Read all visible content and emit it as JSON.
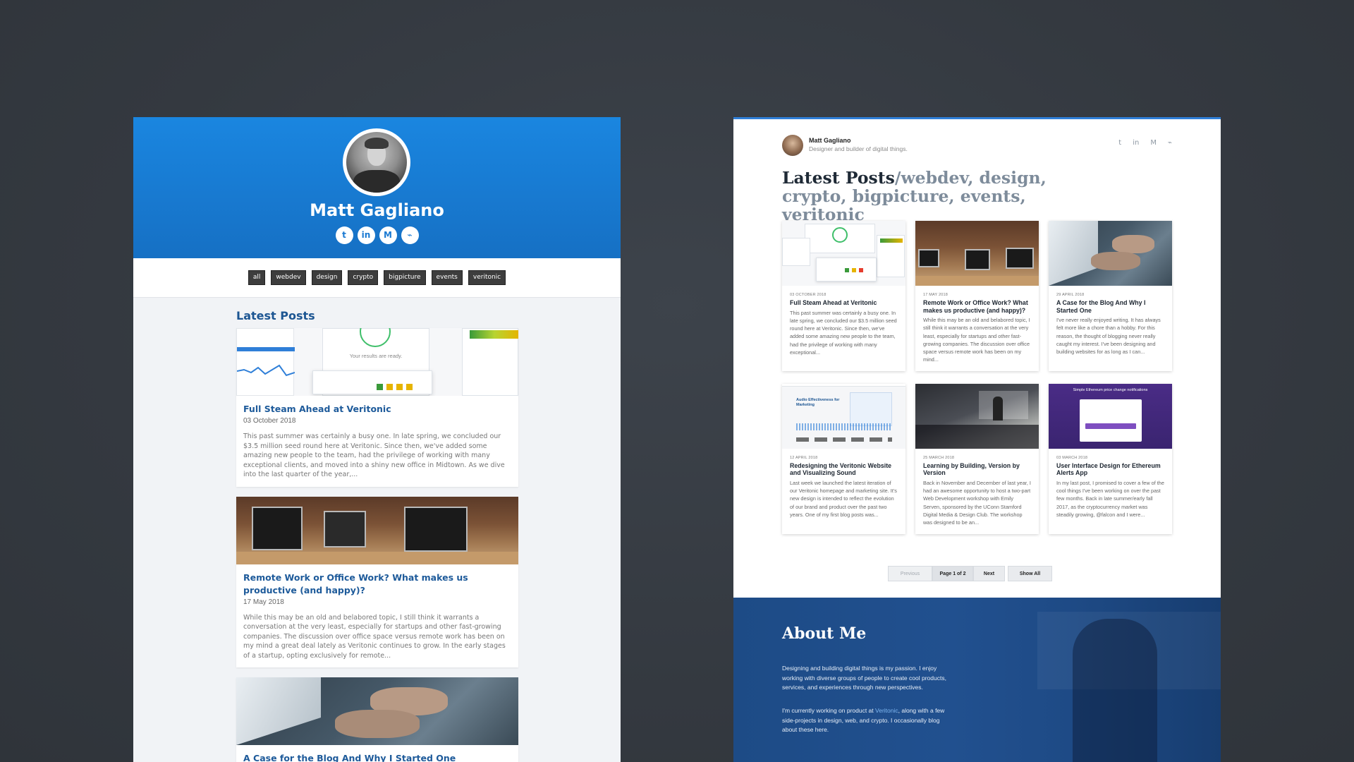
{
  "left": {
    "name": "Matt Gagliano",
    "social": [
      {
        "icon": "twitter-icon",
        "glyph": "t"
      },
      {
        "icon": "linkedin-icon",
        "glyph": "in"
      },
      {
        "icon": "medium-icon",
        "glyph": "M"
      },
      {
        "icon": "github-icon",
        "glyph": "⌁"
      }
    ],
    "tags": [
      "all",
      "webdev",
      "design",
      "crypto",
      "bigpicture",
      "events",
      "veritonic"
    ],
    "heading": "Latest Posts",
    "posts": [
      {
        "title": "Full Steam Ahead at Veritonic",
        "date": "03 October 2018",
        "excerpt": "This past summer was certainly a busy one. In late spring, we concluded our $3.5 million seed round here at Veritonic. Since then, we've added some amazing new people to the team, had the privilege of working with many exceptional clients, and moved into a shiny new office in Midtown. As we dive into the last quarter of the year,...",
        "img_text": "Your results are ready."
      },
      {
        "title": "Remote Work or Office Work? What makes us productive (and happy)?",
        "date": "17 May 2018",
        "excerpt": "While this may be an old and belabored topic, I still think it warrants a conversation at the very least, especially for startups and other fast-growing companies. The discussion over office space versus remote work has been on my mind a great deal lately as Veritonic continues to grow. In the early stages of a startup, opting exclusively for remote..."
      },
      {
        "title": "A Case for the Blog And Why I Started One"
      }
    ]
  },
  "right": {
    "name": "Matt Gagliano",
    "tagline": "Designer and builder of digital things.",
    "social": [
      {
        "icon": "twitter-icon",
        "glyph": "t"
      },
      {
        "icon": "linkedin-icon",
        "glyph": "in"
      },
      {
        "icon": "medium-icon",
        "glyph": "M"
      },
      {
        "icon": "github-icon",
        "glyph": "⌁"
      }
    ],
    "title": "Latest Posts",
    "title_sep": "/",
    "title_cats": "webdev, design, crypto, bigpicture, events, veritonic",
    "posts": [
      {
        "date": "03 October 2018",
        "title": "Full Steam Ahead at Veritonic",
        "excerpt": "This past summer was certainly a busy one. In late spring, we concluded our $3.5 million seed round here at Veritonic. Since then, we've added some amazing new people to the team, had the privilege of working with many exceptional...",
        "img": "veritonic"
      },
      {
        "date": "17 May 2018",
        "title": "Remote Work or Office Work? What makes us productive (and happy)?",
        "excerpt": "While this may be an old and belabored topic, I still think it warrants a conversation at the very least, especially for startups and other fast-growing companies. The discussion over office space versus remote work has been on my mind...",
        "img": "office"
      },
      {
        "date": "29 April 2018",
        "title": "A Case for the Blog And Why I Started One",
        "excerpt": "I've never really enjoyed writing. It has always felt more like a chore than a hobby. For this reason, the thought of blogging never really caught my interest. I've been designing and building websites for as long as I can...",
        "img": "laptop"
      },
      {
        "date": "12 April 2018",
        "title": "Redesigning the Veritonic Website and Visualizing Sound",
        "excerpt": "Last week we launched the latest iteration of our Veritonic homepage and marketing site. It's new design is intended to reflect the evolution of our brand and product over the past two years. One of my first blog posts was...",
        "img": "redesign",
        "img_text": "Audio Effectiveness for Marketing"
      },
      {
        "date": "25 March 2018",
        "title": "Learning by Building, Version by Version",
        "excerpt": "Back in November and December of last year, I had an awesome opportunity to host a two-part Web Development workshop with Emily Serven, sponsored by the UConn Stamford Digital Media & Design Club. The workshop was designed to be an...",
        "img": "class"
      },
      {
        "date": "03 March 2018",
        "title": "User Interface Design for Ethereum Alerts App",
        "excerpt": "In my last post, I promised to cover a few of the cool things I've been working on over the past few months. Back in late summer/early fall 2017, as the cryptocurrency market was steadily growing, @falcon and I were...",
        "img": "purple",
        "img_text": "Simple Ethereum price change notifications"
      }
    ],
    "pager": {
      "prev": "Previous",
      "page": "Page 1 of 2",
      "next": "Next",
      "all": "Show All"
    },
    "about": {
      "title": "About Me",
      "p1": "Designing and building digital things is my passion. I enjoy working with diverse groups of people to create cool products, services, and experiences through new perspectives.",
      "p2_a": "I'm currently working on product at ",
      "p2_link": "Veritonic",
      "p2_b": ", along with a few side-projects in design, web, and crypto. I occasionally blog about these here."
    }
  },
  "colors": {
    "accent": "#1a86e0",
    "link": "#1d5a9a",
    "about_bg": "#1d4b86"
  }
}
